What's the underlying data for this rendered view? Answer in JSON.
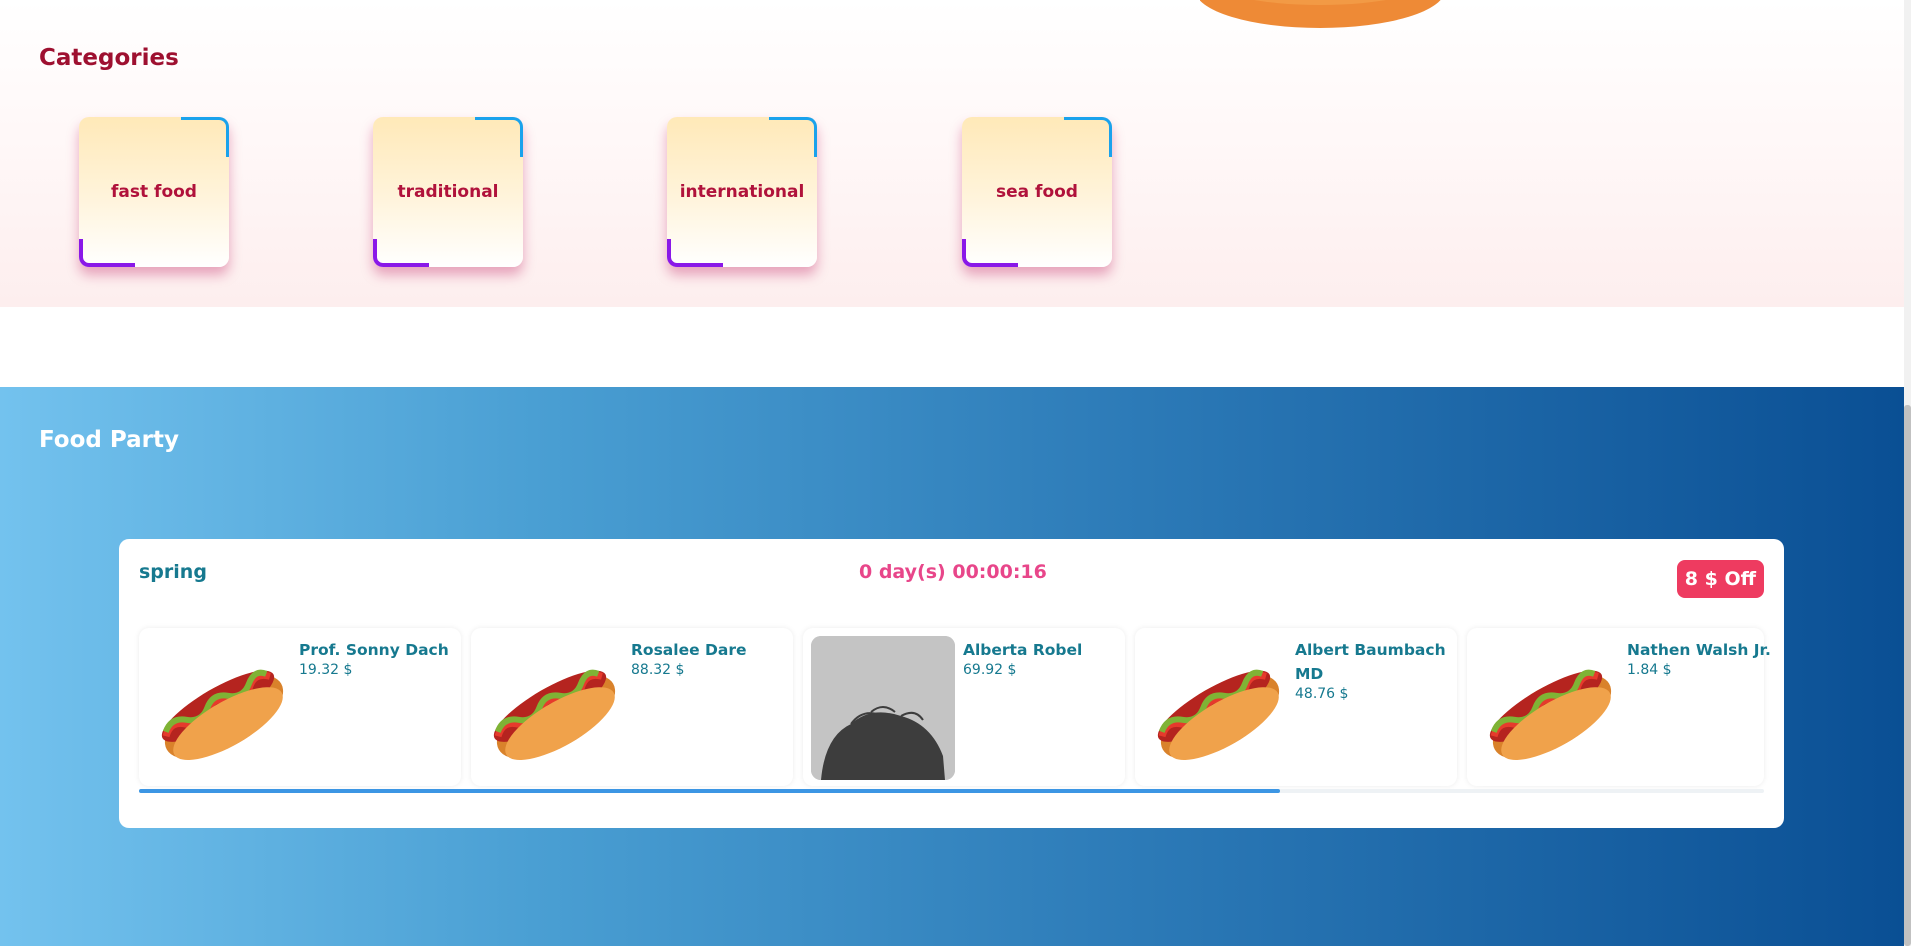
{
  "categories": {
    "title": "Categories",
    "items": [
      {
        "label": "fast food"
      },
      {
        "label": "traditional"
      },
      {
        "label": "international"
      },
      {
        "label": "sea food"
      }
    ]
  },
  "food_party": {
    "title": "Food Party",
    "restaurant": "spring",
    "timer": "0 day(s) 00:00:16",
    "discount_badge": "8 $ Off",
    "progress_fraction": 0.702,
    "items": [
      {
        "name": "Prof. Sonny Dach",
        "price": "19.32 $",
        "image": "hotdog"
      },
      {
        "name": "Rosalee Dare",
        "price": "88.32 $",
        "image": "hotdog"
      },
      {
        "name": "Alberta Robel",
        "price": "69.92 $",
        "image": "grayscale-photo"
      },
      {
        "name": "Albert Baumbach MD",
        "price": "48.76 $",
        "image": "hotdog"
      },
      {
        "name": "Nathen Walsh Jr.",
        "price": "1.84 $",
        "image": "hotdog"
      }
    ]
  },
  "colors": {
    "category_text": "#b0123b",
    "item_text": "#16798f",
    "timer": "#e8468a",
    "badge": "#ee3b60",
    "progress": "#3c96e4"
  }
}
